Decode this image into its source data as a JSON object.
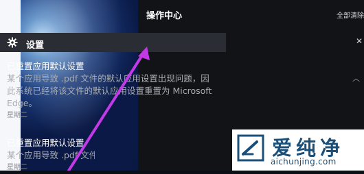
{
  "action_center": {
    "title": "操作中心",
    "clear_all": "全部清除"
  },
  "group": {
    "icon": "gear-icon",
    "title": "设置",
    "close_icon": "close-icon"
  },
  "notifications": [
    {
      "title": "已重置应用默认设置",
      "body": "某个应用导致 .pdf 文件的默认应用设置出现问题，因此系统已经将该文件的默认应用设置重置为 Microsoft Edge。",
      "time": "星期二"
    },
    {
      "title": "已重置应用默认设置",
      "body": "某个应用导致 .pdf 文件",
      "time": "星期二"
    }
  ],
  "watermark": {
    "name": "爱纯净",
    "url": "aichunjing.com"
  },
  "colors": {
    "annotation_arrow": "#c23ae6",
    "panel_bg": "#111317",
    "group_header_bg": "#2a2d33",
    "watermark_text": "#1a4f7a"
  }
}
